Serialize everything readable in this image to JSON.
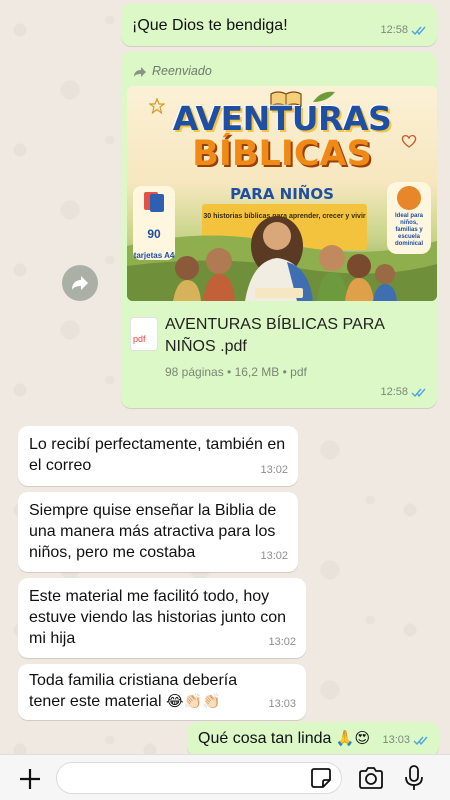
{
  "messages": [
    {
      "text": "¡Que Dios te bendiga!",
      "time": "12:58"
    },
    {
      "forwarded_label": "Reenviado",
      "cover": {
        "title_line1": "AVENTURAS",
        "title_line2": "BÍBLICAS",
        "title_line3": "PARA NIÑOS",
        "subtitle": "30 historias bíblicas para aprender, crecer y vivir la fe",
        "badge_left_num": "90",
        "badge_left_text": "tarjetas A4",
        "badge_right_text": "Ideal para niños, familias y escuela dominical"
      },
      "doc_icon_label": "pdf",
      "doc_name": "AVENTURAS BÍBLICAS PARA NIÑOS .pdf",
      "doc_info": "98 páginas • 16,2 MB • pdf",
      "time": "12:58"
    },
    {
      "text": "Lo recibí perfectamente, también en el correo",
      "time": "13:02"
    },
    {
      "text": "Siempre quise enseñar la Biblia de una manera más atractiva para los niños, pero me costaba",
      "time": "13:02"
    },
    {
      "text": "Este material me facilitó todo, hoy estuve viendo las historias junto con mi hija",
      "time": "13:02"
    },
    {
      "text": "Toda familia cristiana debería tener este material",
      "emoji": "😂👏🏻👏🏻",
      "time": "13:03"
    },
    {
      "text": "Qué cosa tan linda",
      "emoji": "🙏😍",
      "time": "13:03"
    }
  ],
  "composer": {
    "placeholder": ""
  },
  "colors": {
    "outgoing": "#dcf8c6",
    "incoming": "#ffffff",
    "read_ticks": "#4fa3e0"
  }
}
